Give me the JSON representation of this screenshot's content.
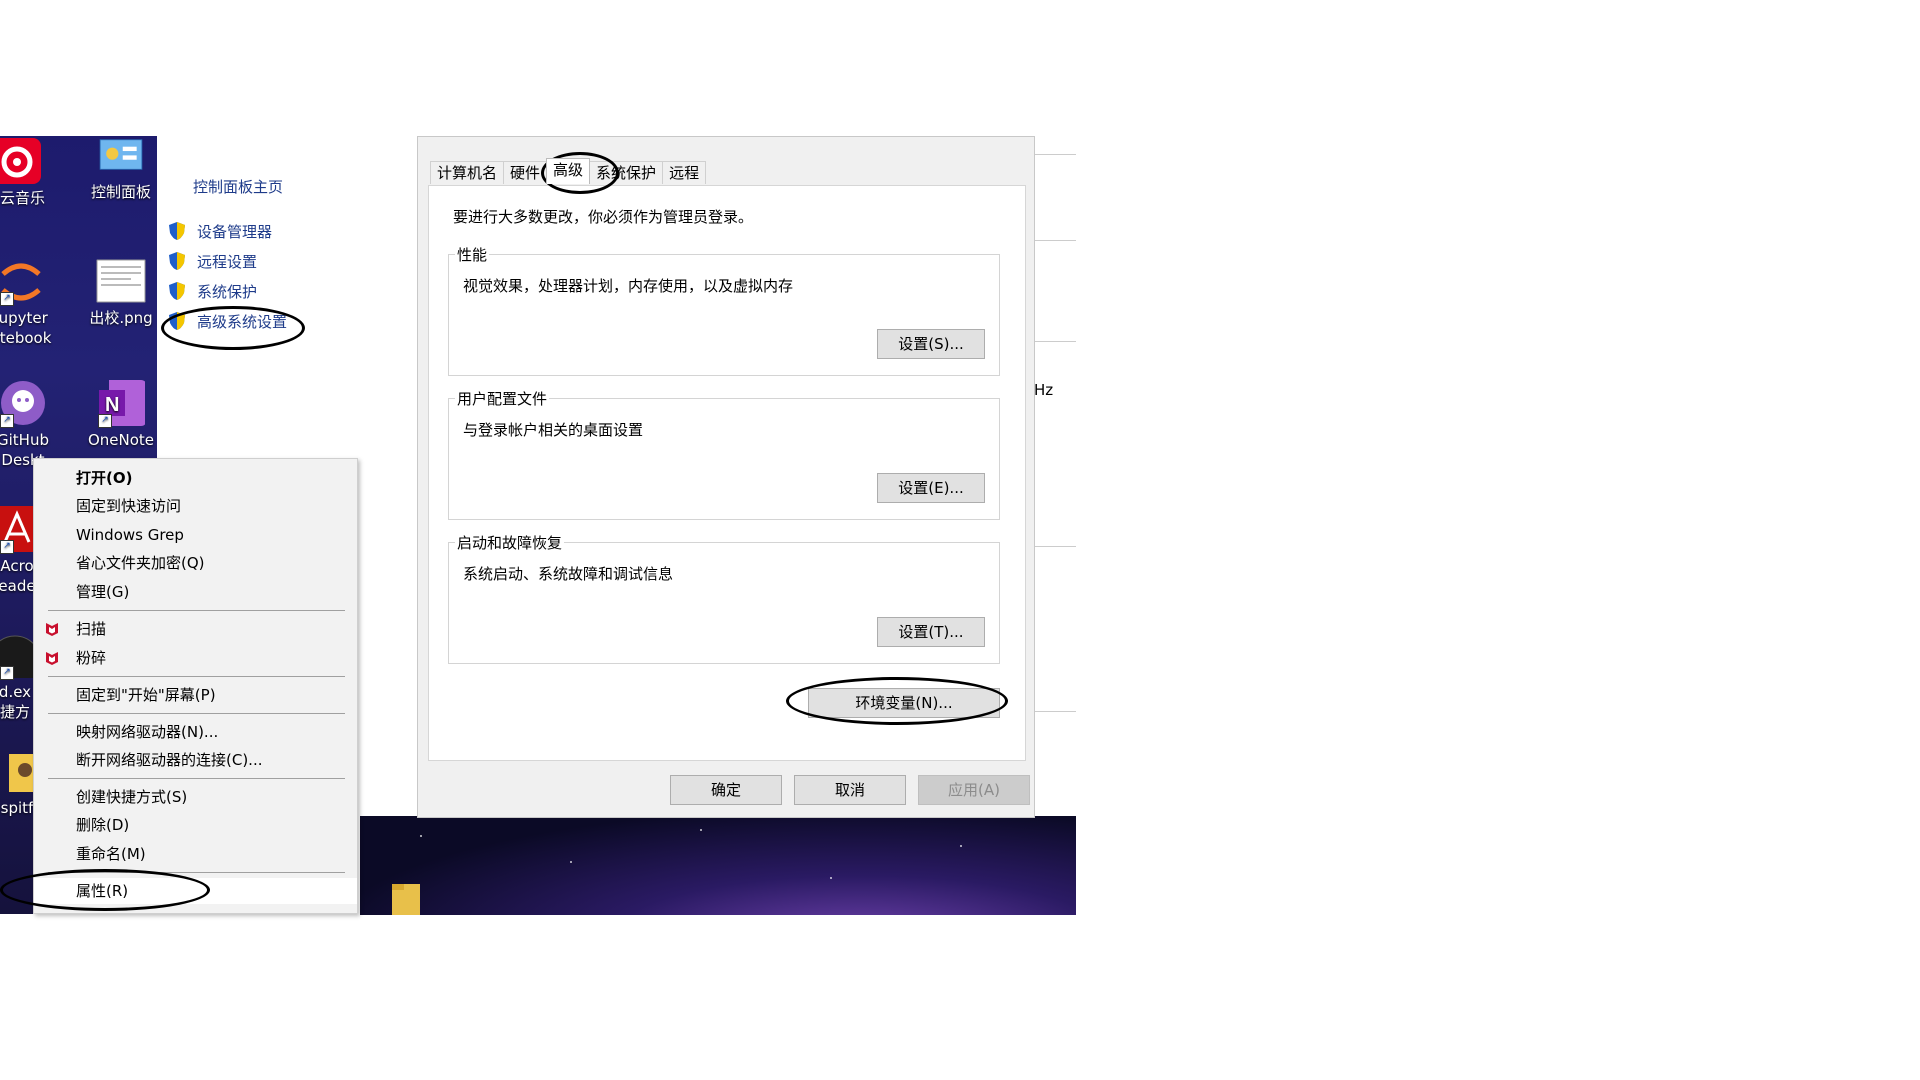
{
  "desktop": {
    "icons": [
      {
        "label": "易云音乐",
        "icon": "netease-music-icon"
      },
      {
        "label": "控制面板",
        "icon": "control-panel-icon"
      },
      {
        "label": "Jupyter\notebook",
        "label_lines": [
          "Jupyter",
          "otebook"
        ],
        "icon": "jupyter-icon"
      },
      {
        "label": "出校.png",
        "icon": "image-file-icon"
      },
      {
        "label_lines": [
          "GitHub",
          "Deskt"
        ],
        "icon": "github-desktop-icon"
      },
      {
        "label": "OneNote",
        "icon": "onenote-icon"
      },
      {
        "label_lines": [
          "Acro",
          "eade"
        ],
        "icon": "acrobat-icon"
      },
      {
        "label_lines": [
          "d.ex",
          "捷方"
        ],
        "icon": "exe-shortcut-icon"
      },
      {
        "label_lines": [
          "spitf"
        ],
        "icon": "user-folder-icon"
      }
    ]
  },
  "control_panel": {
    "home_link": "控制面板主页",
    "links": [
      "设备管理器",
      "远程设置",
      "系统保护",
      "高级系统设置"
    ]
  },
  "background_window": {
    "fragment": "Hz"
  },
  "dialog": {
    "tabs": [
      "计算机名",
      "硬件",
      "高级",
      "系统保护",
      "远程"
    ],
    "active_tab": "高级",
    "notice": "要进行大多数更改，你必须作为管理员登录。",
    "groups": [
      {
        "title": "性能",
        "desc": "视觉效果，处理器计划，内存使用，以及虚拟内存",
        "button": "设置(S)..."
      },
      {
        "title": "用户配置文件",
        "desc": "与登录帐户相关的桌面设置",
        "button": "设置(E)..."
      },
      {
        "title": "启动和故障恢复",
        "desc": "系统启动、系统故障和调试信息",
        "button": "设置(T)..."
      }
    ],
    "env_button": "环境变量(N)...",
    "ok": "确定",
    "cancel": "取消",
    "apply": "应用(A)"
  },
  "context_menu": {
    "items": [
      {
        "label": "打开(O)"
      },
      {
        "label": "固定到快速访问"
      },
      {
        "label": "Windows Grep"
      },
      {
        "label": "省心文件夹加密(Q)"
      },
      {
        "label": "管理(G)"
      },
      {
        "label": "扫描",
        "icon": "mcafee-icon"
      },
      {
        "label": "粉碎",
        "icon": "mcafee-icon"
      },
      {
        "label": "固定到\"开始\"屏幕(P)"
      },
      {
        "label": "映射网络驱动器(N)..."
      },
      {
        "label": "断开网络驱动器的连接(C)..."
      },
      {
        "label": "创建快捷方式(S)"
      },
      {
        "label": "删除(D)"
      },
      {
        "label": "重命名(M)"
      },
      {
        "label": "属性(R)"
      }
    ]
  },
  "colors": {
    "link": "#1e3b8a",
    "dialog_bg": "#f0f0f0",
    "annotation": "#000000"
  }
}
